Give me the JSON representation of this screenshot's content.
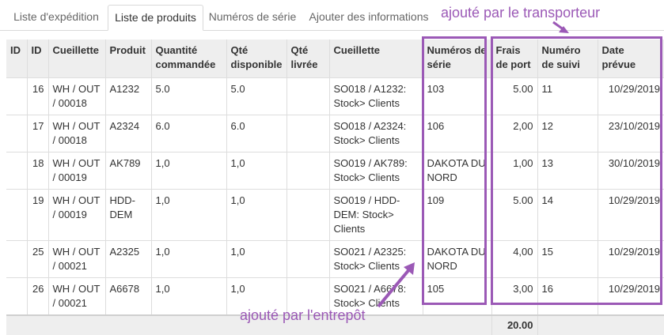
{
  "tabs": [
    {
      "label": "Liste d'expédition"
    },
    {
      "label": "Liste de produits",
      "active": true
    },
    {
      "label": "Numéros de série"
    },
    {
      "label": "Ajouter des informations"
    }
  ],
  "annotations": {
    "carrier": "ajouté par le transporteur",
    "warehouse": "ajouté par l'entrepôt",
    "color": "#9b59b6"
  },
  "table": {
    "headers": {
      "id1": "ID",
      "id2": "ID",
      "picking": "Cueillette",
      "product": "Produit",
      "qty_ordered": "Quantité commandée",
      "qty_available": "Qté disponible",
      "qty_delivered": "Qté livrée",
      "picking2": "Cueillette",
      "serials": "Numéros de série",
      "shipping": "Frais de port",
      "tracking": "Numéro de suivi",
      "due_date": "Date prévue"
    },
    "rows": [
      {
        "id1": "",
        "id2": "16",
        "picking": "WH / OUT / 00018",
        "product": "A1232",
        "qty_ordered": "5.0",
        "qty_available": "5.0",
        "qty_delivered": "",
        "picking2": "SO018 / A1232: Stock> Clients",
        "serials": "103",
        "shipping": "5.00",
        "tracking": "11",
        "due_date": "10/29/2019"
      },
      {
        "id1": "",
        "id2": "17",
        "picking": "WH / OUT / 00018",
        "product": "A2324",
        "qty_ordered": "6.0",
        "qty_available": "6.0",
        "qty_delivered": "",
        "picking2": "SO018 / A2324: Stock> Clients",
        "serials": "106",
        "shipping": "2,00",
        "tracking": "12",
        "due_date": "23/10/2019"
      },
      {
        "id1": "",
        "id2": "18",
        "picking": "WH / OUT / 00019",
        "product": "AK789",
        "qty_ordered": "1,0",
        "qty_available": "1,0",
        "qty_delivered": "",
        "picking2": "SO019 / AK789: Stock> Clients",
        "serials": "DAKOTA DU NORD",
        "shipping": "1,00",
        "tracking": "13",
        "due_date": "30/10/2019"
      },
      {
        "id1": "",
        "id2": "19",
        "picking": "WH / OUT / 00019",
        "product": "HDD-DEM",
        "qty_ordered": "1,0",
        "qty_available": "1,0",
        "qty_delivered": "",
        "picking2": "SO019 / HDD-DEM: Stock> Clients",
        "serials": "109",
        "shipping": "5.00",
        "tracking": "14",
        "due_date": "10/29/2019"
      },
      {
        "id1": "",
        "id2": "25",
        "picking": "WH / OUT / 00021",
        "product": "A2325",
        "qty_ordered": "1,0",
        "qty_available": "1,0",
        "qty_delivered": "",
        "picking2": "SO021 / A2325: Stock> Clients",
        "serials": "DAKOTA DU NORD",
        "shipping": "4,00",
        "tracking": "15",
        "due_date": "10/29/2019"
      },
      {
        "id1": "",
        "id2": "26",
        "picking": "WH / OUT / 00021",
        "product": "A6678",
        "qty_ordered": "1,0",
        "qty_available": "1,0",
        "qty_delivered": "",
        "picking2": "SO021 / A6678: Stock> Clients",
        "serials": "105",
        "shipping": "3,00",
        "tracking": "16",
        "due_date": "10/29/2019"
      }
    ],
    "total_shipping": "20.00"
  }
}
